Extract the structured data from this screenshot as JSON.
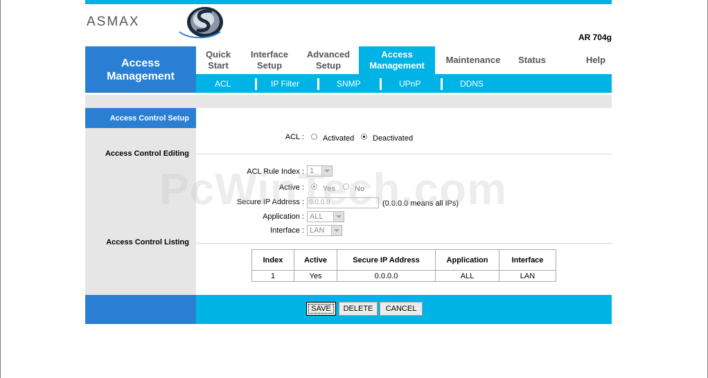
{
  "brand": {
    "logo_text": "ASMAX",
    "model": "AR 704g"
  },
  "nav": {
    "section_title": "Access Management",
    "tabs": [
      {
        "label": "Quick Start",
        "active": false
      },
      {
        "label": "Interface Setup",
        "active": false
      },
      {
        "label": "Advanced Setup",
        "active": false
      },
      {
        "label": "Access Management",
        "active": true
      },
      {
        "label": "Maintenance",
        "active": false
      },
      {
        "label": "Status",
        "active": false
      },
      {
        "label": "Help",
        "active": false
      }
    ],
    "subtabs": [
      "ACL",
      "IP Filter",
      "SNMP",
      "UPnP",
      "DDNS"
    ]
  },
  "sidebar": {
    "heading": "Access Control Setup",
    "editing": "Access Control Editing",
    "listing": "Access Control Listing"
  },
  "form": {
    "acl_label": "ACL :",
    "acl_options": [
      "Activated",
      "Deactivated"
    ],
    "acl_selected": "Deactivated",
    "rule_index_label": "ACL Rule Index :",
    "rule_index_value": "1",
    "active_label": "Active :",
    "active_options": [
      "Yes",
      "No"
    ],
    "active_selected": "Yes",
    "secure_ip_label": "Secure IP Address :",
    "secure_ip_value": "0.0.0.0",
    "secure_ip_hint": "(0.0.0.0 means all IPs)",
    "application_label": "Application :",
    "application_value": "ALL",
    "interface_label": "Interface :",
    "interface_value": "LAN"
  },
  "table": {
    "headers": [
      "Index",
      "Active",
      "Secure IP Address",
      "Application",
      "Interface"
    ],
    "rows": [
      [
        "1",
        "Yes",
        "0.0.0.0",
        "ALL",
        "LAN"
      ]
    ]
  },
  "buttons": {
    "save": "SAVE",
    "delete": "DELETE",
    "cancel": "CANCEL"
  },
  "watermark": "PcWinTech.com",
  "colors": {
    "accent": "#00b3e6",
    "brand_blue": "#2a7fd4",
    "panel_grey": "#e6e6e6"
  }
}
